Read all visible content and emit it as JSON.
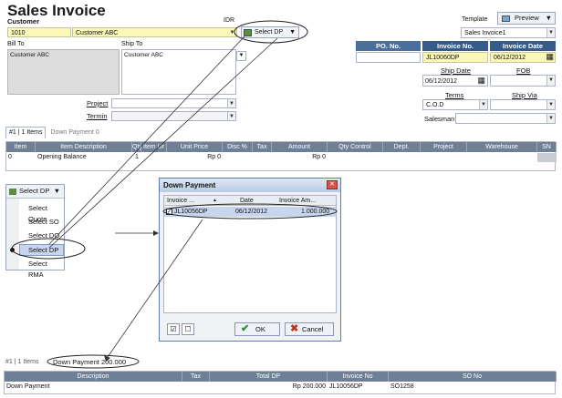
{
  "header": {
    "title": "Sales Invoice",
    "customer_label": "Customer",
    "customer_code": "1010",
    "customer_name": "Customer ABC",
    "currency": "IDR",
    "select_dp_label": "Select DP",
    "template_label": "Template",
    "template_value": "Sales Invoice1",
    "preview_label": "Preview"
  },
  "bill_to": {
    "label": "Bill To",
    "value": "Customer ABC"
  },
  "ship_to": {
    "label": "Ship To",
    "value": "Customer ABC"
  },
  "po": {
    "label": "PO. No.",
    "value": ""
  },
  "invoice_no": {
    "label": "Invoice No.",
    "value": "JL10060DP"
  },
  "invoice_date": {
    "label": "Invoice Date",
    "value": "06/12/2012"
  },
  "ship_date": {
    "label": "Ship Date",
    "value": "06/12/2012"
  },
  "fob": {
    "label": "FOB",
    "value": ""
  },
  "terms": {
    "label": "Terms",
    "value": "C.O.D"
  },
  "ship_via": {
    "label": "Ship Via",
    "value": ""
  },
  "salesman": {
    "label": "Salesman",
    "value": ""
  },
  "project": {
    "label": "Project"
  },
  "termin": {
    "label": "Termin"
  },
  "tabs": {
    "items": "#1 | 1 Items",
    "down_payment": "Down Payment  0"
  },
  "items_table": {
    "columns": [
      "Item",
      "Item Description",
      "Qty",
      "Item Ur",
      "Unit Price",
      "Disc %",
      "Tax",
      "Amount",
      "Qty Control",
      "Dept.",
      "Project",
      "Warehouse",
      "SN"
    ],
    "rows": [
      [
        "0",
        "Opening Balance",
        "1",
        "",
        "Rp 0",
        "",
        "",
        "Rp 0",
        "",
        "",
        "",
        "",
        ""
      ]
    ]
  },
  "select_menu": {
    "button": "Select DP",
    "items": [
      "Select Quote",
      "Select SO",
      "Select DO",
      "Select DP",
      "Select RMA"
    ],
    "selected": "Select DP"
  },
  "dialog": {
    "title": "Down Payment",
    "columns": [
      "Invoice ...",
      "Date",
      "Invoice Am..."
    ],
    "rows": [
      [
        "JL10056DP",
        "06/12/2012",
        "1.000.000"
      ]
    ],
    "ok": "OK",
    "cancel": "Cancel"
  },
  "bottom_tabs": {
    "items": "#1 | 1 Items",
    "down_payment": "Down Payment  200.000"
  },
  "dp_table": {
    "columns": [
      "Description",
      "Tax",
      "Total DP",
      "Invoice No",
      "SO No"
    ],
    "rows": [
      [
        "Down Payment",
        "",
        "Rp 200.000",
        "JL10056DP",
        "SO1258"
      ]
    ]
  },
  "colors": {
    "header_blue": "#355b8a",
    "grid_header": "#6f7f96",
    "yellow_field": "#fbf7b6",
    "selection": "#c7d6ee"
  }
}
